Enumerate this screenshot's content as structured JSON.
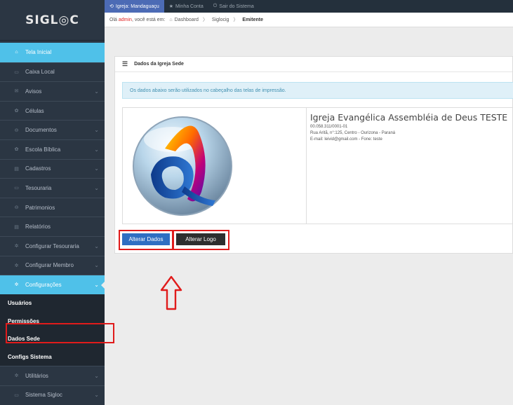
{
  "app": {
    "logo_text": "SIGL◎C"
  },
  "topbar": {
    "items": [
      {
        "icon": "⟲",
        "label": "Igreja: Mandaguaçu"
      },
      {
        "icon": "★",
        "label": "Minha Conta"
      },
      {
        "icon": "⏻",
        "label": "Sair do Sistema"
      }
    ]
  },
  "breadcrumb": {
    "greeting": "Olá ",
    "user": "admin",
    "rest": ", você está em:",
    "home_icon": "⌂",
    "item1": "Dashboard",
    "item2": "Siglocig",
    "current": "Emitente",
    "sep": "〉"
  },
  "sidebar": {
    "items": [
      {
        "icon": "⌂",
        "label": "Tela Inicial"
      },
      {
        "icon": "▭",
        "label": "Caixa Local"
      },
      {
        "icon": "✉",
        "label": "Avisos",
        "chevron": "⌄"
      },
      {
        "icon": "✿",
        "label": "Células"
      },
      {
        "icon": "⊖",
        "label": "Documentos",
        "chevron": "⌄"
      },
      {
        "icon": "✿",
        "label": "Escola Bíblica",
        "chevron": "⌄"
      },
      {
        "icon": "▤",
        "label": "Cadastros",
        "chevron": "⌄"
      },
      {
        "icon": "▭",
        "label": "Tesouraria",
        "chevron": "⌄"
      },
      {
        "icon": "⊖",
        "label": "Patrimonios"
      },
      {
        "icon": "▤",
        "label": "Relatórios"
      },
      {
        "icon": "✲",
        "label": "Configurar Tesouraria",
        "chevron": "⌄"
      },
      {
        "icon": "✲",
        "label": "Configurar Membro",
        "chevron": "⌄"
      },
      {
        "icon": "✲",
        "label": "Configurações",
        "chevron": "⌄"
      }
    ],
    "sub_items": [
      {
        "label": "Usuários"
      },
      {
        "label": "Permissões"
      },
      {
        "label": "Dados Sede"
      },
      {
        "label": "Configs Sistema"
      }
    ],
    "bottom_items": [
      {
        "icon": "✲",
        "label": "Utilitários",
        "chevron": "⌄"
      },
      {
        "icon": "▭",
        "label": "Sistema Sigloc",
        "chevron": "⌄"
      }
    ]
  },
  "portlet": {
    "icon": "☰",
    "title": "Dados da Igreja Sede",
    "alert": "Os dados abaixo serão utilizados no cabeçalho das telas de impressão."
  },
  "church": {
    "name": "Igreja Evangélica Assembléia de Deus TESTE",
    "cnpj": "00.058.311/0001-01",
    "address": "Rua Aritã, n°:125, Centro - Ourizona - Paraná",
    "contact": "E-mail: leivid@gmail.com - Fone: teste"
  },
  "buttons": {
    "alterar_dados": "Alterar Dados",
    "alterar_logo": "Alterar Logo"
  },
  "colors": {
    "accent": "#4fc1e9",
    "sidebar": "#2b3643",
    "primary_button": "#2f6ec2",
    "highlight_red": "#e01b1b"
  }
}
